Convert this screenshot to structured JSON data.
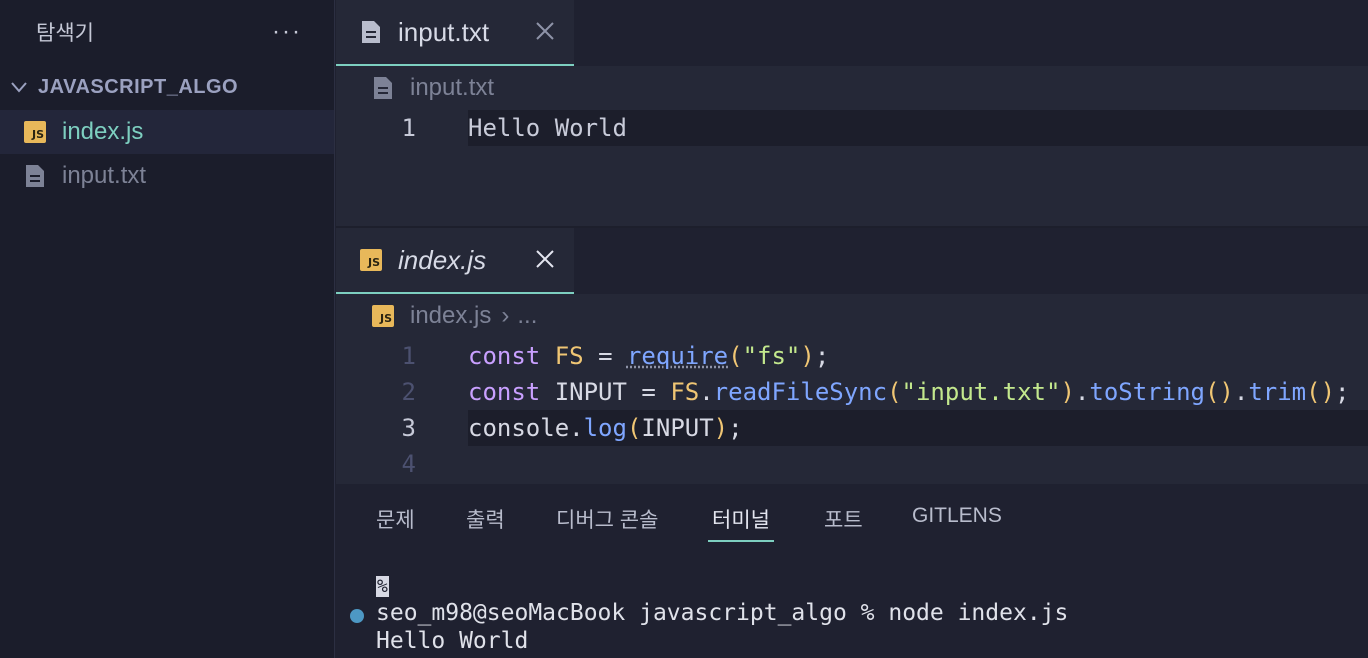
{
  "sidebar": {
    "title": "탐색기",
    "more_label": "···",
    "folder": "JAVASCRIPT_ALGO",
    "files": [
      {
        "name": "index.js",
        "icon": "js-file-icon",
        "color": "#7dcfc0"
      },
      {
        "name": "input.txt",
        "icon": "text-file-icon",
        "color": "#7d8296"
      }
    ]
  },
  "editor_top": {
    "tab_label": "input.txt",
    "breadcrumb": "input.txt",
    "lines": [
      {
        "number": "1",
        "text": "Hello World"
      }
    ]
  },
  "editor_bottom": {
    "tab_label": "index.js",
    "breadcrumb": "index.js",
    "breadcrumb_more": "...",
    "line_numbers": [
      "1",
      "2",
      "3",
      "4"
    ],
    "code": {
      "l1": [
        "const",
        " ",
        "FS",
        " ",
        "=",
        " ",
        "require",
        "(",
        "\"fs\"",
        ")",
        ";"
      ],
      "l2": [
        "const",
        " INPUT ",
        "=",
        " ",
        "FS",
        ".",
        "readFileSync",
        "(",
        "\"input.txt\"",
        ")",
        ".",
        "toString",
        "()",
        ".",
        "trim",
        "()",
        ";"
      ],
      "l3": [
        "console",
        ".",
        "log",
        "(",
        "INPUT",
        ")",
        ";"
      ]
    }
  },
  "panel": {
    "tabs": [
      "문제",
      "출력",
      "디버그 콘솔",
      "터미널",
      "포트",
      "GITLENS"
    ],
    "active_tab": "터미널",
    "terminal": {
      "prompt_glyph": "%",
      "command_line": "seo_m98@seoMacBook javascript_algo % node index.js",
      "output": "Hello World"
    }
  },
  "colors": {
    "accent": "#7dcfc0",
    "keyword": "#c9a0ff",
    "constant": "#f0c674",
    "function": "#7fa6ff",
    "string": "#c3e88d"
  }
}
